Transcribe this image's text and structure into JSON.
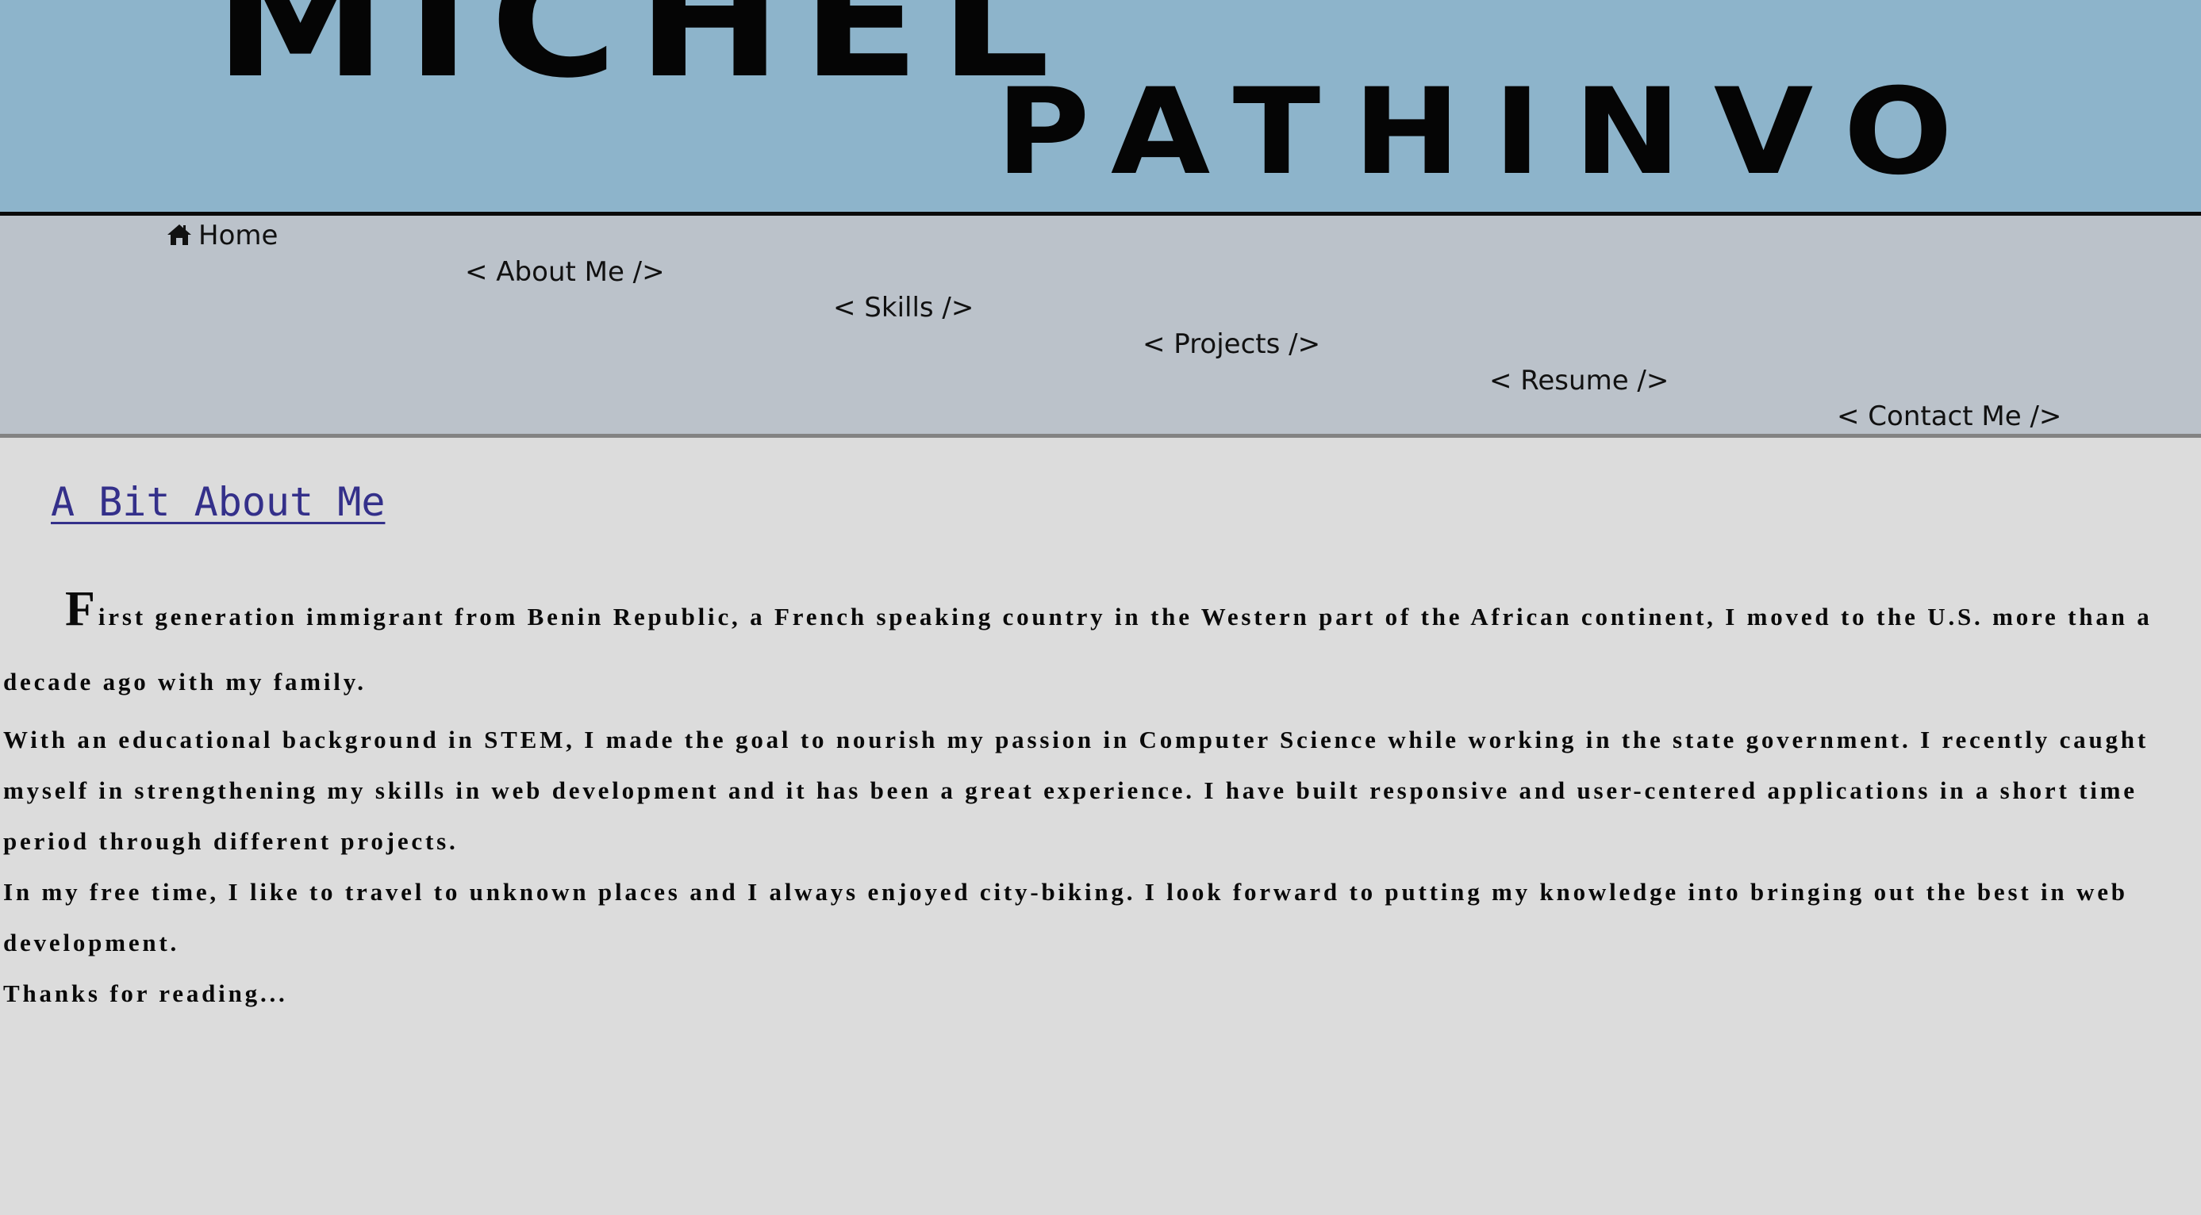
{
  "header": {
    "first_name": "michel",
    "last_name": "pathinvo"
  },
  "nav": {
    "home": "Home",
    "about": "< About Me />",
    "skills": "< Skills />",
    "projects": "< Projects />",
    "resume": "< Resume />",
    "contact": "< Contact Me />"
  },
  "about": {
    "title": "A Bit About Me",
    "paragraphs": [
      "First generation immigrant from Benin Republic, a French speaking country in the Western part of the African continent, I moved to the U.S. more than a decade ago with my family.",
      "With an educational background in STEM, I made the goal to nourish my passion in Computer Science while working in the state government. I recently caught myself in strengthening my skills in web development and it has been a great experience. I have built responsive and user-centered applications in a short time period through different projects.",
      "In my free time, I like to travel to unknown places and I always enjoyed city-biking. I look forward to putting my knowledge into bringing out the best in web development.",
      "Thanks for reading..."
    ]
  },
  "colors": {
    "header_bg": "#8db4cb",
    "nav_bg": "#bbc2ca",
    "page_bg": "#dcdcdc",
    "title_link": "#34308a"
  },
  "icons": {
    "home": "home-icon"
  }
}
